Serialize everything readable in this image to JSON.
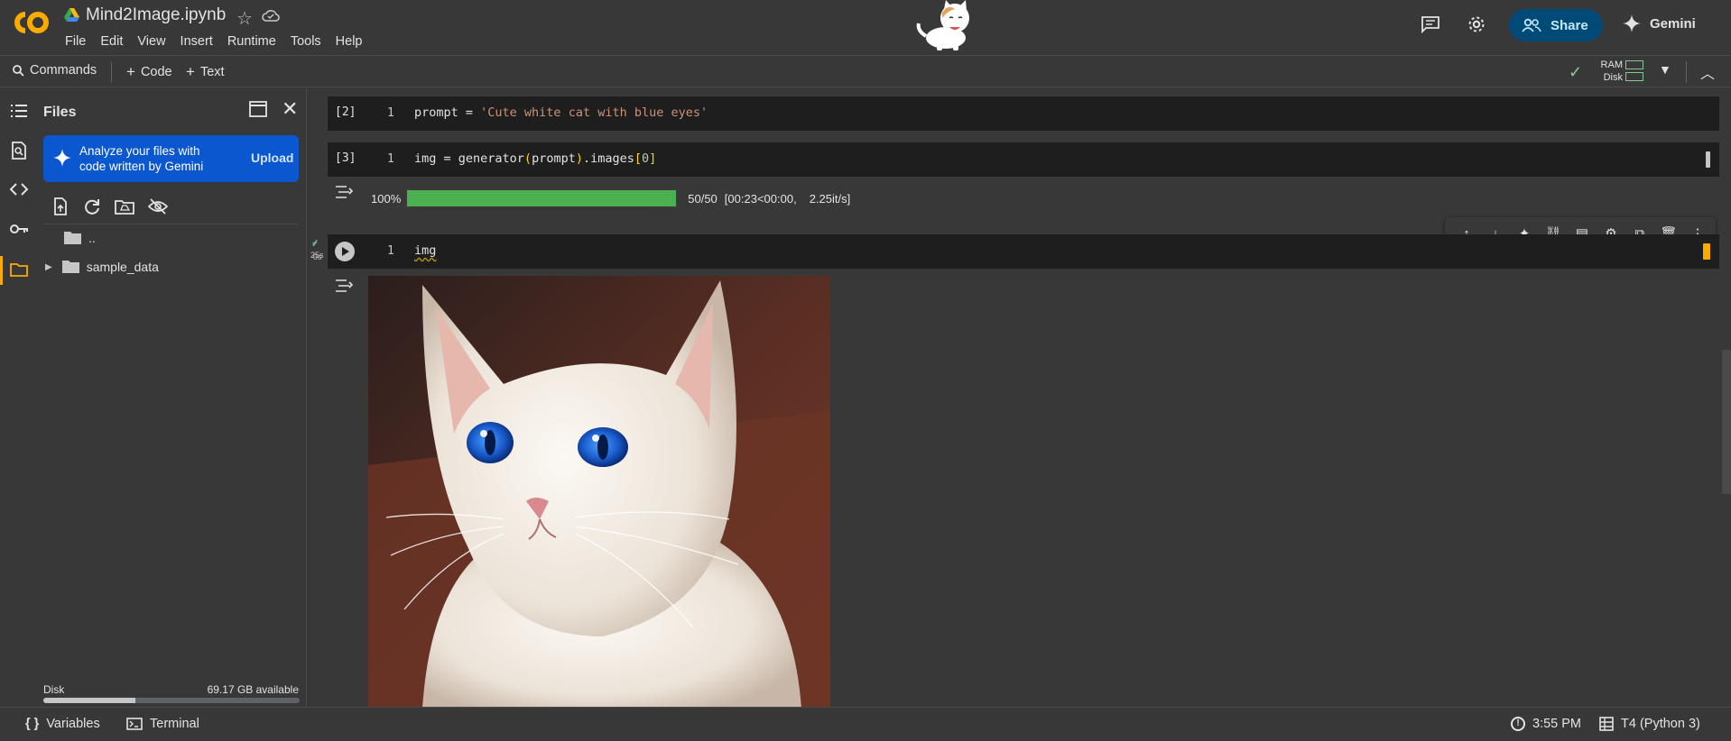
{
  "header": {
    "notebook_title": "Mind2Image.ipynb",
    "menu": [
      "File",
      "Edit",
      "View",
      "Insert",
      "Runtime",
      "Tools",
      "Help"
    ],
    "share_label": "Share",
    "gemini_label": "Gemini"
  },
  "toolbar": {
    "commands_label": "Commands",
    "code_label": "Code",
    "text_label": "Text",
    "ram_label": "RAM",
    "disk_label": "Disk"
  },
  "files_panel": {
    "title": "Files",
    "banner_text": "Analyze your files with code written by Gemini",
    "banner_action": "Upload",
    "tree": [
      {
        "name": ".."
      },
      {
        "name": "sample_data"
      }
    ],
    "disk_label": "Disk",
    "disk_available": "69.17 GB available",
    "disk_used_fraction": 0.36
  },
  "cells": [
    {
      "exec": "[2]",
      "line": "1",
      "code": "prompt = 'Cute white cat with blue eyes'",
      "code_prefix": "prompt = ",
      "code_string": "'Cute white cat with blue eyes'"
    },
    {
      "exec": "[3]",
      "line": "1",
      "status_time": "25s",
      "code_a": "img = generator",
      "code_b": "prompt",
      "code_c": ".images",
      "code_d": "0"
    },
    {
      "line": "1",
      "status_time": "0s",
      "code": "img"
    }
  ],
  "progress": {
    "percent_label": "100%",
    "count": "50/50",
    "timing": "[00:23<00:00,",
    "rate": "2.25it/s]",
    "fraction": 1.0
  },
  "cell_toolbar_icons": [
    "arrow-up-icon",
    "arrow-down-icon",
    "sparkle-icon",
    "link-icon",
    "comment-icon",
    "gear-icon",
    "mirror-cell-icon",
    "trash-icon",
    "more-vert-icon"
  ],
  "statusbar": {
    "variables_label": "Variables",
    "terminal_label": "Terminal",
    "time": "3:55 PM",
    "runtime": "T4 (Python 3)"
  },
  "colors": {
    "accent_orange": "#f9ab00",
    "progress_green": "#4caf50",
    "share_blue": "#004a77",
    "banner_blue": "#0b57d0",
    "ok_green": "#81c995"
  }
}
